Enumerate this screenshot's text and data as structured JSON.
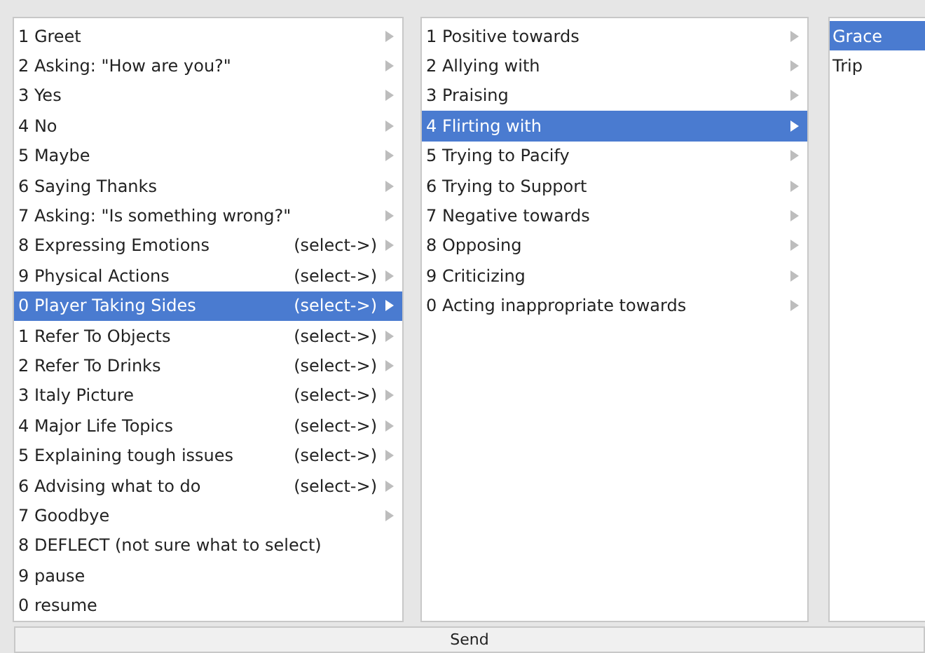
{
  "columns": [
    {
      "items": [
        {
          "label": "1 Greet",
          "submenu": true,
          "selected": false
        },
        {
          "label": "2 Asking: \"How are you?\"",
          "submenu": true,
          "selected": false
        },
        {
          "label": "3 Yes",
          "submenu": true,
          "selected": false
        },
        {
          "label": "4 No",
          "submenu": true,
          "selected": false
        },
        {
          "label": "5 Maybe",
          "submenu": true,
          "selected": false
        },
        {
          "label": "6 Saying Thanks",
          "submenu": true,
          "selected": false
        },
        {
          "label": "7 Asking: \"Is something wrong?\"",
          "submenu": true,
          "selected": false
        },
        {
          "label": "8 Expressing Emotions",
          "hint": "(select->)",
          "submenu": true,
          "selected": false
        },
        {
          "label": "9 Physical Actions",
          "hint": "(select->)",
          "submenu": true,
          "selected": false
        },
        {
          "label": "0 Player Taking Sides",
          "hint": "(select->)",
          "submenu": true,
          "selected": true
        },
        {
          "label": "1 Refer To Objects",
          "hint": "(select->)",
          "submenu": true,
          "selected": false
        },
        {
          "label": "2 Refer To Drinks",
          "hint": "(select->)",
          "submenu": true,
          "selected": false
        },
        {
          "label": "3 Italy Picture",
          "hint": "(select->)",
          "submenu": true,
          "selected": false
        },
        {
          "label": "4 Major Life Topics",
          "hint": "(select->)",
          "submenu": true,
          "selected": false
        },
        {
          "label": "5 Explaining tough issues",
          "hint": "(select->)",
          "submenu": true,
          "selected": false
        },
        {
          "label": "6 Advising what to do",
          "hint": "(select->)",
          "submenu": true,
          "selected": false
        },
        {
          "label": "7 Goodbye",
          "submenu": true,
          "selected": false
        },
        {
          "label": "8 DEFLECT (not sure what to select)",
          "submenu": false,
          "selected": false
        },
        {
          "label": "9 pause",
          "submenu": false,
          "selected": false
        },
        {
          "label": "0 resume",
          "submenu": false,
          "selected": false
        }
      ]
    },
    {
      "items": [
        {
          "label": "1 Positive towards",
          "submenu": true,
          "selected": false
        },
        {
          "label": "2 Allying with",
          "submenu": true,
          "selected": false
        },
        {
          "label": "3 Praising",
          "submenu": true,
          "selected": false
        },
        {
          "label": "4 Flirting with",
          "submenu": true,
          "selected": true
        },
        {
          "label": "5 Trying to Pacify",
          "submenu": true,
          "selected": false
        },
        {
          "label": "6 Trying to Support",
          "submenu": true,
          "selected": false
        },
        {
          "label": "7 Negative towards",
          "submenu": true,
          "selected": false
        },
        {
          "label": "8 Opposing",
          "submenu": true,
          "selected": false
        },
        {
          "label": "9 Criticizing",
          "submenu": true,
          "selected": false
        },
        {
          "label": "0 Acting inappropriate towards",
          "submenu": true,
          "selected": false
        }
      ]
    },
    {
      "items": [
        {
          "label": "Grace",
          "submenu": false,
          "selected": true
        },
        {
          "label": "Trip",
          "submenu": false,
          "selected": false
        }
      ]
    }
  ],
  "send_button": "Send"
}
